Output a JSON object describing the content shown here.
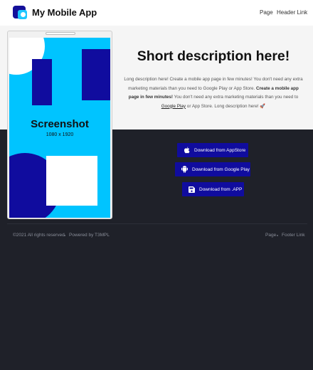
{
  "header": {
    "app_title": "My Mobile App",
    "nav": {
      "page": "Page",
      "header_link": "Header Link"
    }
  },
  "hero": {
    "title": "Short description here!",
    "desc_part1": "Long description here! Create a mobile app page in few minutes! You don't need any extra marketing materials than you need to Google Play or App Store. ",
    "desc_bold": "Create a mobile app page in few minutes!",
    "desc_part2": " You don't need any extra marketing materials than you need to ",
    "desc_link": "Google Play",
    "desc_part3": " or App Store. Long description here! ",
    "desc_emoji": "🚀"
  },
  "screenshot": {
    "label": "Screenshot",
    "size": "1080 x 1920"
  },
  "downloads": [
    {
      "label": "Download from AppStore",
      "icon": "apple-icon"
    },
    {
      "label": "Download from Google Play",
      "icon": "android-icon"
    },
    {
      "label": "Download from .APP",
      "icon": "save-disk-icon"
    }
  ],
  "footer": {
    "copyright": "©2021 All rights reserved",
    "powered": "Powered by T3MPL",
    "links": {
      "page": "Page",
      "footer_link": "Footer Link"
    }
  },
  "colors": {
    "brand": "#100c9e",
    "accent": "#00c4ff",
    "dark_bg": "#1f2129",
    "hero_bg": "#f5f5f5"
  }
}
